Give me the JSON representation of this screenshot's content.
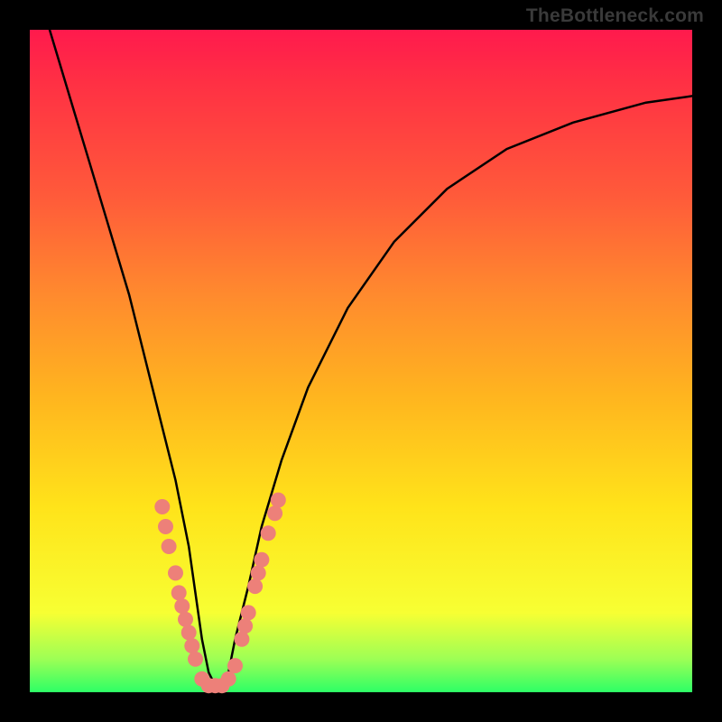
{
  "watermark": "TheBottleneck.com",
  "chart_data": {
    "type": "line",
    "title": "",
    "xlabel": "",
    "ylabel": "",
    "xlim": [
      0,
      100
    ],
    "ylim": [
      0,
      100
    ],
    "grid": false,
    "legend": false,
    "background_gradient": {
      "direction": "vertical",
      "stops": [
        {
          "pos": 0.0,
          "color": "#ff1a4d"
        },
        {
          "pos": 0.25,
          "color": "#ff5a3a"
        },
        {
          "pos": 0.55,
          "color": "#ffb41f"
        },
        {
          "pos": 0.88,
          "color": "#f7ff33"
        },
        {
          "pos": 1.0,
          "color": "#2dff66"
        }
      ]
    },
    "series": [
      {
        "name": "bottleneck-curve",
        "x": [
          3,
          6,
          9,
          12,
          15,
          18,
          20,
          22,
          24,
          25,
          26,
          27,
          28,
          29,
          30,
          31,
          33,
          35,
          38,
          42,
          48,
          55,
          63,
          72,
          82,
          93,
          100
        ],
        "y": [
          100,
          90,
          80,
          70,
          60,
          48,
          40,
          32,
          22,
          15,
          8,
          3,
          1,
          1,
          3,
          8,
          16,
          25,
          35,
          46,
          58,
          68,
          76,
          82,
          86,
          89,
          90
        ]
      }
    ],
    "scatter_points": {
      "name": "highlight-dots",
      "color": "#ed8079",
      "points": [
        {
          "x": 20.0,
          "y": 28
        },
        {
          "x": 20.5,
          "y": 25
        },
        {
          "x": 21.0,
          "y": 22
        },
        {
          "x": 22.0,
          "y": 18
        },
        {
          "x": 22.5,
          "y": 15
        },
        {
          "x": 23.0,
          "y": 13
        },
        {
          "x": 23.5,
          "y": 11
        },
        {
          "x": 24.0,
          "y": 9
        },
        {
          "x": 24.5,
          "y": 7
        },
        {
          "x": 25.0,
          "y": 5
        },
        {
          "x": 26.0,
          "y": 2
        },
        {
          "x": 27.0,
          "y": 1
        },
        {
          "x": 28.0,
          "y": 1
        },
        {
          "x": 29.0,
          "y": 1
        },
        {
          "x": 30.0,
          "y": 2
        },
        {
          "x": 31.0,
          "y": 4
        },
        {
          "x": 32.0,
          "y": 8
        },
        {
          "x": 32.5,
          "y": 10
        },
        {
          "x": 33.0,
          "y": 12
        },
        {
          "x": 34.0,
          "y": 16
        },
        {
          "x": 34.5,
          "y": 18
        },
        {
          "x": 35.0,
          "y": 20
        },
        {
          "x": 36.0,
          "y": 24
        },
        {
          "x": 37.0,
          "y": 27
        },
        {
          "x": 37.5,
          "y": 29
        }
      ]
    },
    "minimum": {
      "x": 28,
      "y": 1
    }
  }
}
